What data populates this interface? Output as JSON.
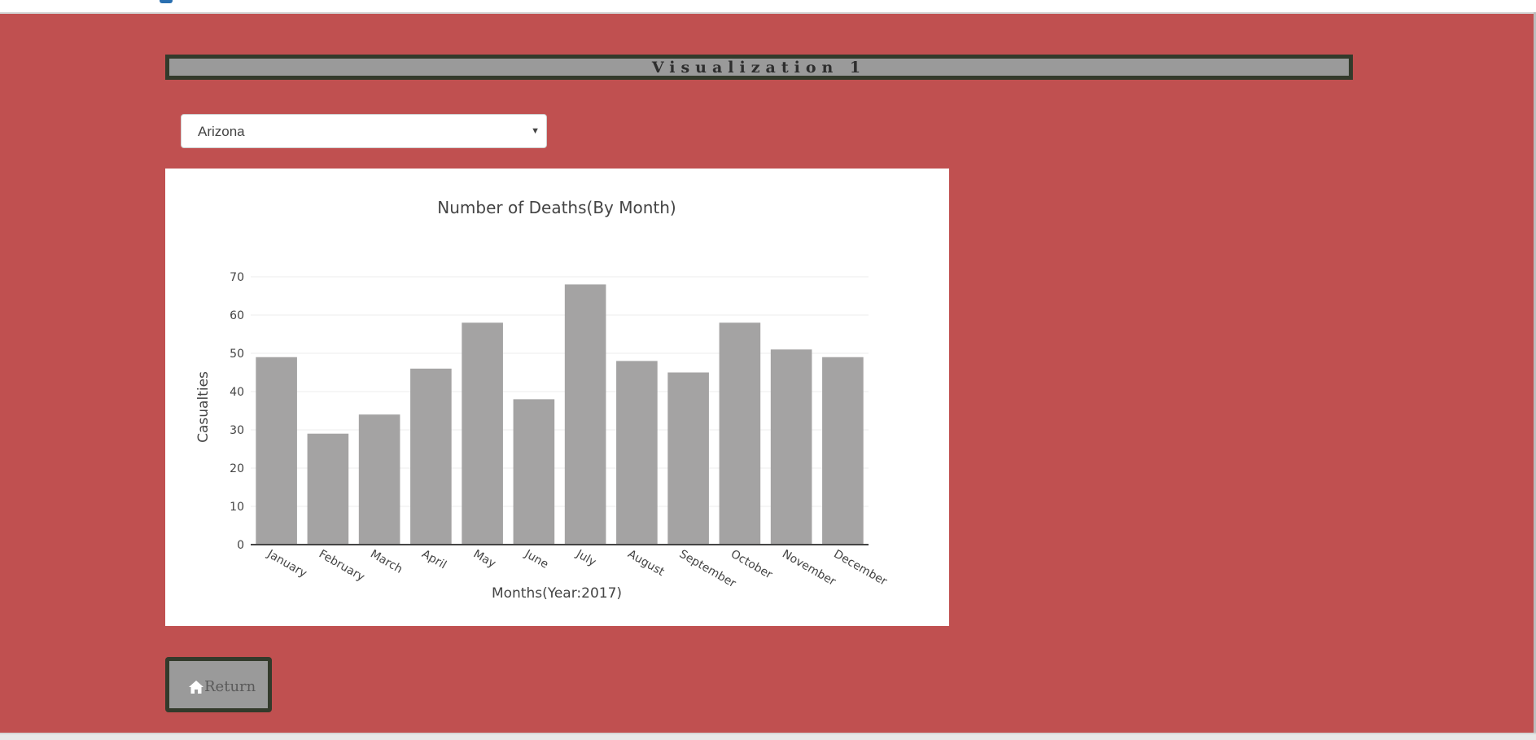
{
  "page": {
    "banner_title": "Visualization 1",
    "state_select": {
      "selected": "Arizona"
    },
    "return_button": {
      "label": "Return",
      "icon": "home-icon"
    }
  },
  "colors": {
    "background": "#c05050",
    "banner_fill": "#9a9a9a",
    "banner_border": "#333a2b",
    "bar": "#a4a3a3"
  },
  "chart_data": {
    "type": "bar",
    "title": "Number of Deaths(By Month)",
    "xlabel": "Months(Year:2017)",
    "ylabel": "Casualties",
    "categories": [
      "January",
      "February",
      "March",
      "April",
      "May",
      "June",
      "July",
      "August",
      "September",
      "October",
      "November",
      "December"
    ],
    "values": [
      49,
      29,
      34,
      46,
      58,
      38,
      68,
      48,
      45,
      58,
      51,
      49
    ],
    "ylim": [
      0,
      70
    ],
    "yticks": [
      0,
      10,
      20,
      30,
      40,
      50,
      60,
      70
    ],
    "grid": true,
    "legend": "none"
  }
}
